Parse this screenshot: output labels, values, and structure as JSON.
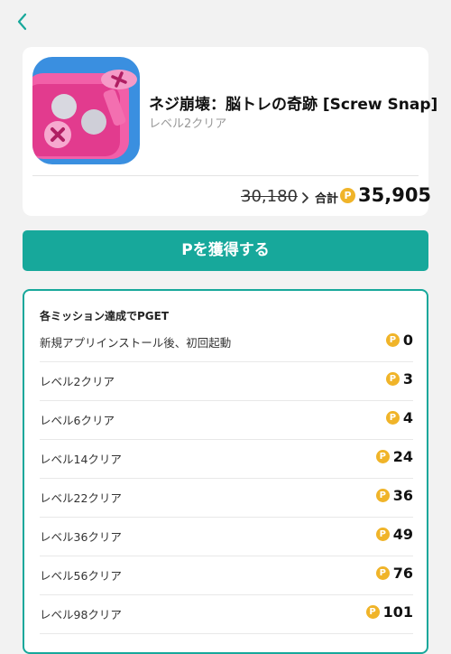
{
  "app": {
    "title": "ネジ崩壊：脳トレの奇跡 [Screw Snap]",
    "subtitle": "レベル2クリア",
    "old_points": "30,180",
    "total_label": "合計",
    "total_points": "35,905"
  },
  "cta": {
    "label": "Pを獲得する"
  },
  "missions": {
    "title": "各ミッション達成でPGET",
    "items": [
      {
        "label": "新規アプリインストール後、初回起動",
        "points": "0"
      },
      {
        "label": "レベル2クリア",
        "points": "3"
      },
      {
        "label": "レベル6クリア",
        "points": "4"
      },
      {
        "label": "レベル14クリア",
        "points": "24"
      },
      {
        "label": "レベル22クリア",
        "points": "36"
      },
      {
        "label": "レベル36クリア",
        "points": "49"
      },
      {
        "label": "レベル56クリア",
        "points": "76"
      },
      {
        "label": "レベル98クリア",
        "points": "101"
      }
    ]
  },
  "coin_symbol": "P",
  "colors": {
    "accent": "#17a89b",
    "coin": "#f0b429"
  },
  "icons": {
    "back": "chevron-left-icon",
    "arrow": "chevron-right-icon",
    "coin": "point-coin-icon"
  }
}
